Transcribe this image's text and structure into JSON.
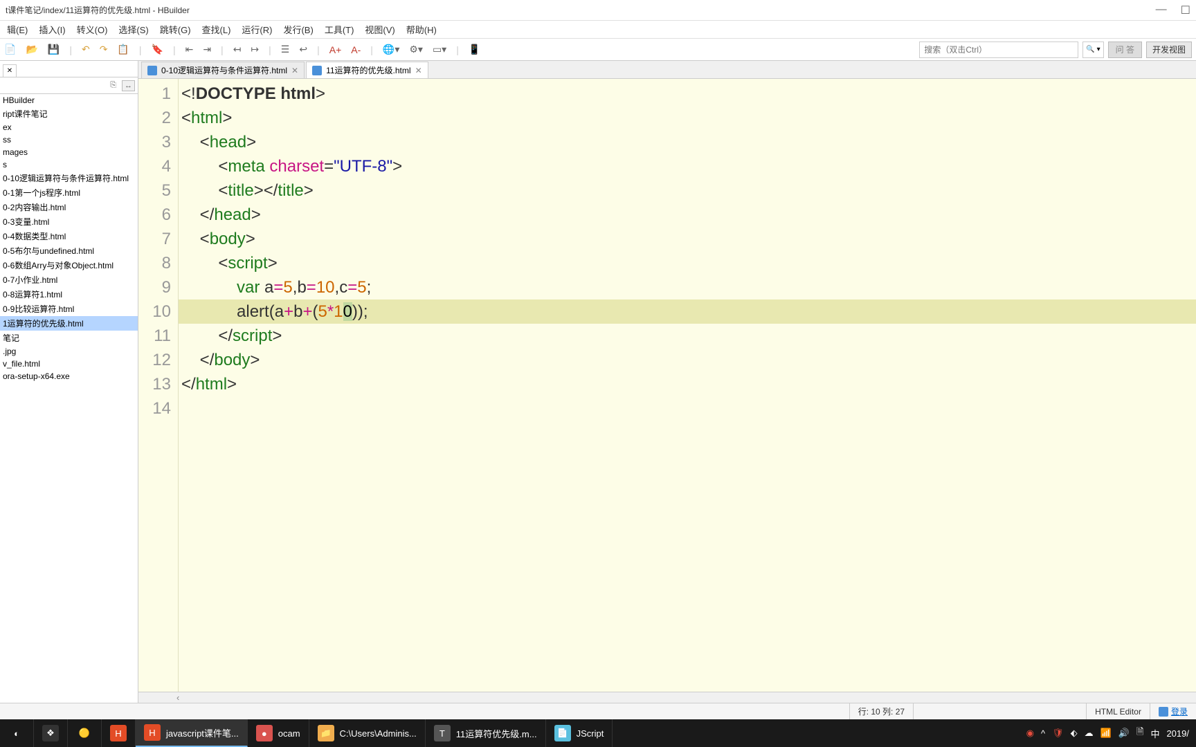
{
  "titlebar": {
    "path": "t课件笔记/index/11运算符的优先级.html  -  HBuilder"
  },
  "menus": [
    "辑(E)",
    "插入(I)",
    "转义(O)",
    "选择(S)",
    "跳转(G)",
    "查找(L)",
    "运行(R)",
    "发行(B)",
    "工具(T)",
    "视图(V)",
    "帮助(H)"
  ],
  "toolbar": {
    "search_placeholder": "搜索（双击Ctrl）",
    "btn_qa": "问 答",
    "btn_dev": "开发视图"
  },
  "file_tree": [
    "HBuilder",
    "ript课件笔记",
    "ex",
    "ss",
    "mages",
    "s",
    "0-10逻辑运算符与条件运算符.html",
    "0-1第一个js程序.html",
    "0-2内容输出.html",
    "0-3变量.html",
    "0-4数据类型.html",
    "0-5布尔与undefined.html",
    "0-6数组Arry与对象Object.html",
    "0-7小作业.html",
    "0-8运算符1.html",
    "0-9比较运算符.html",
    "1运算符的优先级.html",
    "笔记",
    ".jpg",
    "v_file.html",
    "ora-setup-x64.exe"
  ],
  "selected_file_index": 16,
  "editor_tabs": [
    {
      "label": "0-10逻辑运算符与条件运算符.html",
      "active": false
    },
    {
      "label": "11运算符的优先级.html",
      "active": true
    }
  ],
  "code": {
    "line_count": 14,
    "highlight_line": 10
  },
  "statusbar": {
    "cursor": "行: 10 列: 27",
    "mode": "HTML Editor",
    "login": "登录"
  },
  "taskbar": {
    "items": [
      {
        "label": "",
        "color": "#e34c26",
        "icon": "H"
      },
      {
        "label": "javascript课件笔...",
        "color": "#e34c26",
        "icon": "H"
      },
      {
        "label": "ocam",
        "color": "#d9534f",
        "icon": "●"
      },
      {
        "label": "C:\\Users\\Adminis...",
        "color": "#f0ad4e",
        "icon": "📁"
      },
      {
        "label": "11运算符优先级.m...",
        "color": "#555",
        "icon": "T"
      },
      {
        "label": "JScript",
        "color": "#5bc0de",
        "icon": "📄"
      }
    ],
    "date": "2019/"
  }
}
